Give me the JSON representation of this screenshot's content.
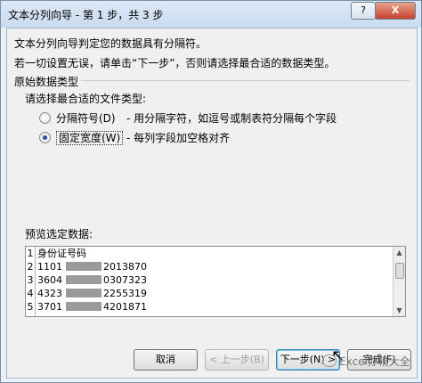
{
  "window": {
    "title": "文本分列向导 - 第 1 步，共 3 步",
    "help_label": "?",
    "close_label": "X"
  },
  "intro": {
    "line1": "文本分列向导判定您的数据具有分隔符。",
    "line2": "若一切设置无误，请单击“下一步”，否则请选择最合适的数据类型。"
  },
  "group": {
    "title": "原始数据类型",
    "choose_label": "请选择最合适的文件类型:",
    "options": [
      {
        "label": "分隔符号(D)",
        "desc": "- 用分隔字符，如逗号或制表符分隔每个字段",
        "checked": false
      },
      {
        "label": "固定宽度(W)",
        "desc": "- 每列字段加空格对齐",
        "checked": true
      }
    ]
  },
  "preview": {
    "label": "预览选定数据:",
    "rows": [
      {
        "num": "1",
        "text": "身份证号码"
      },
      {
        "num": "2",
        "p1": "1101",
        "p2": "2013870"
      },
      {
        "num": "3",
        "p1": "3604",
        "p2": "0307323"
      },
      {
        "num": "4",
        "p1": "4323",
        "p2": "2255319"
      },
      {
        "num": "5",
        "p1": "3701",
        "p2": "4201871"
      }
    ]
  },
  "buttons": {
    "cancel": "取消",
    "back": "< 上一步(B)",
    "next": "下一步(N) >",
    "finish": "完成(F)"
  },
  "watermark": {
    "text": "Excel办精大全"
  }
}
